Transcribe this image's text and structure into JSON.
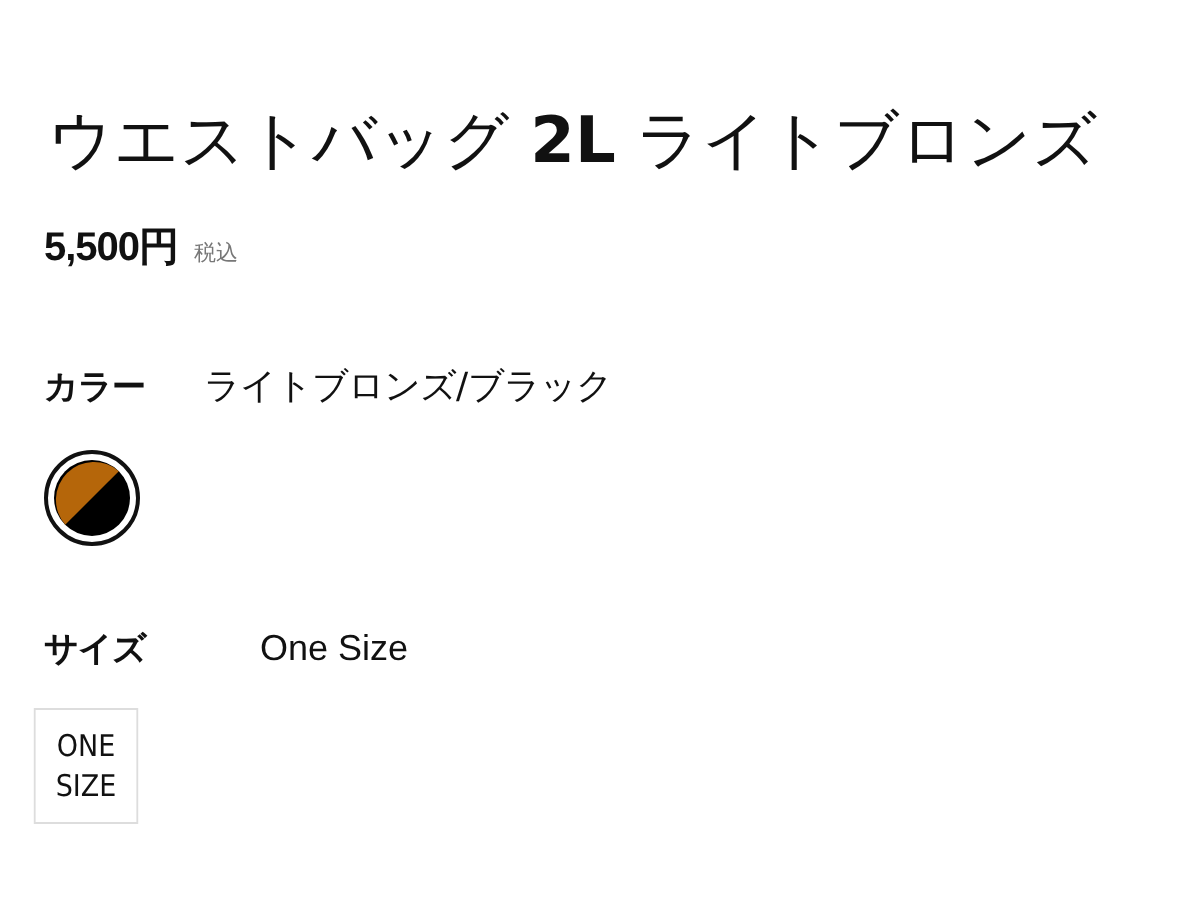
{
  "product": {
    "title": "ウエストバッグ **2L** ライトブロンズ",
    "price": "5,500円",
    "tax_note": "税込"
  },
  "color": {
    "label": "カラー",
    "value": "ライトブロンズ/ブラック",
    "swatches": [
      {
        "selected": true
      }
    ]
  },
  "size": {
    "label": "サイズ",
    "value": "One Size",
    "options": [
      {
        "label": "ONE SIZE",
        "selected": false
      }
    ]
  }
}
